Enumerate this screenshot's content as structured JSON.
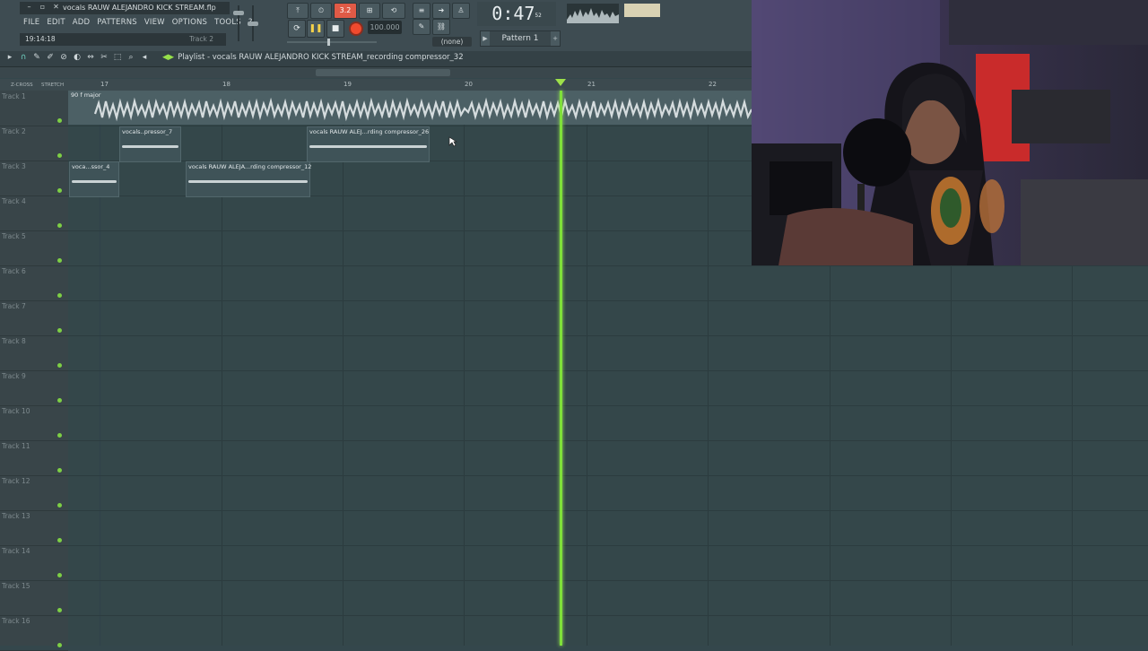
{
  "window": {
    "file_title": "vocals RAUW ALEJANDRO KICK STREAM.flp",
    "hint_time": "19:14:18",
    "hint_track": "Track 2"
  },
  "menu": [
    "FILE",
    "EDIT",
    "ADD",
    "PATTERNS",
    "VIEW",
    "OPTIONS",
    "TOOLS",
    "?"
  ],
  "toolbar": {
    "mode_label": "3.2",
    "tempo": "100.000",
    "snap": "(none)",
    "time": "0:47",
    "time_sub": "52",
    "time_unit": "M:S:CS",
    "pattern": "Pattern 1"
  },
  "playlist": {
    "title": "Playlist - vocals RAUW ALEJANDRO KICK STREAM_recording compressor_32",
    "mini_labels": [
      "Z-CROSS",
      "STRETCH"
    ],
    "ruler": [
      "17",
      "18",
      "19",
      "20",
      "21",
      "22"
    ],
    "tracks": [
      "Track 1",
      "Track 2",
      "Track 3",
      "Track 4",
      "Track 5",
      "Track 6",
      "Track 7",
      "Track 8",
      "Track 9",
      "Track 10",
      "Track 11",
      "Track 12",
      "Track 13",
      "Track 14",
      "Track 15",
      "Track 16"
    ],
    "audio_clip": "90 f major",
    "clips": [
      "vocals..pressor_7",
      "vocals RAUW ALEJ...rding compressor_26",
      "voca...ssor_4",
      "vocals RAUW ALEJA...rding compressor_12"
    ]
  },
  "colors": {
    "playhead": "#7fe03a",
    "record": "#f04a2e",
    "grid_bg": "#34474a"
  }
}
